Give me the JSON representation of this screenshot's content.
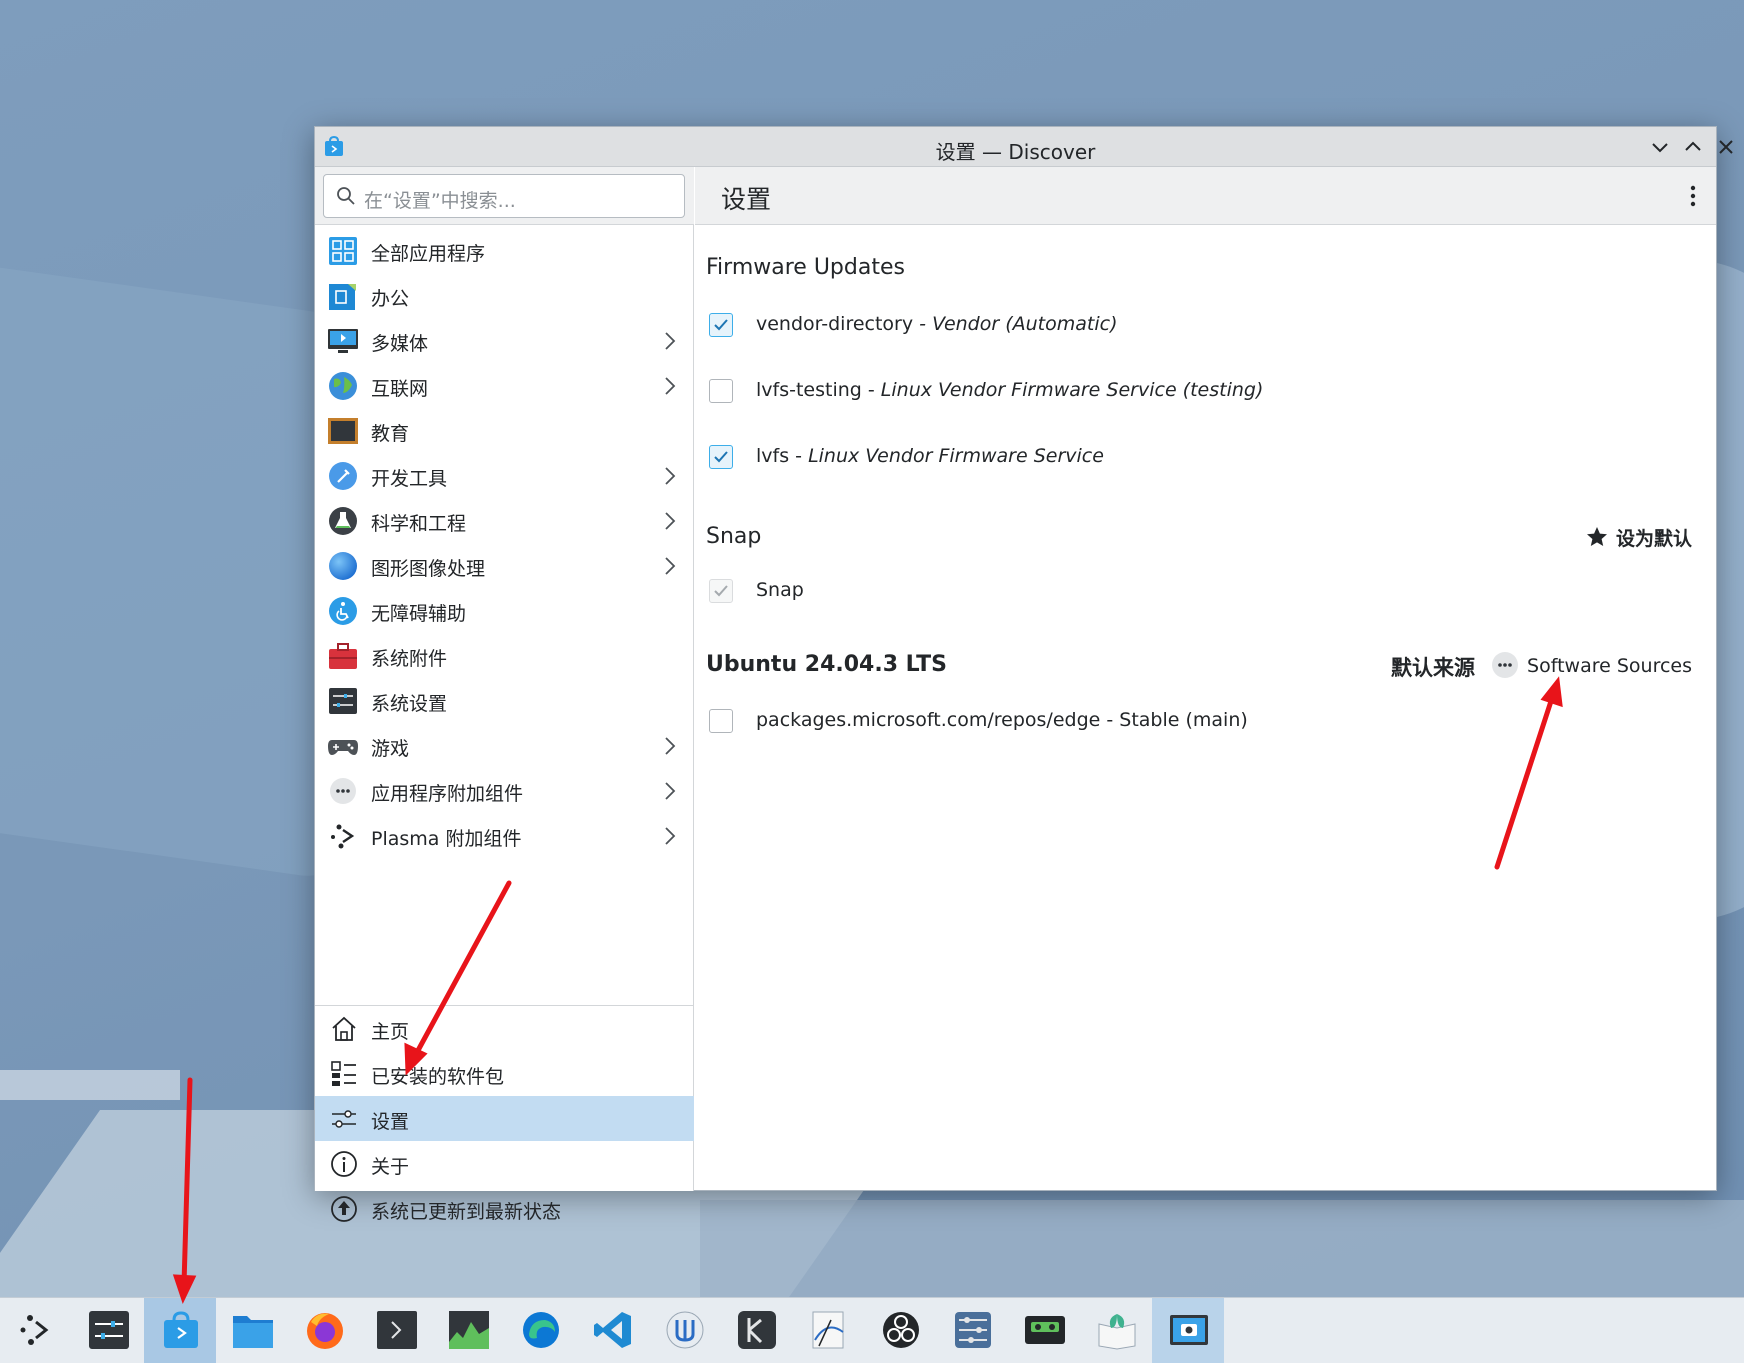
{
  "window": {
    "title": "设置 — Discover",
    "controls": [
      "chevron-down-icon",
      "chevron-up-icon",
      "close-icon"
    ]
  },
  "sidebar": {
    "search_placeholder": "在“设置”中搜索...",
    "categories": [
      {
        "label": "全部应用程序",
        "icon": "all-apps-icon",
        "has_children": false
      },
      {
        "label": "办公",
        "icon": "office-icon",
        "has_children": false
      },
      {
        "label": "多媒体",
        "icon": "multimedia-icon",
        "has_children": true
      },
      {
        "label": "互联网",
        "icon": "internet-globe-icon",
        "has_children": true
      },
      {
        "label": "教育",
        "icon": "education-blackboard-icon",
        "has_children": false
      },
      {
        "label": "开发工具",
        "icon": "development-tools-icon",
        "has_children": true
      },
      {
        "label": "科学和工程",
        "icon": "science-flask-icon",
        "has_children": true
      },
      {
        "label": "图形图像处理",
        "icon": "graphics-icon",
        "has_children": true
      },
      {
        "label": "无障碍辅助",
        "icon": "accessibility-icon",
        "has_children": false
      },
      {
        "label": "系统附件",
        "icon": "toolbox-icon",
        "has_children": false
      },
      {
        "label": "系统设置",
        "icon": "system-settings-icon",
        "has_children": false
      },
      {
        "label": "游戏",
        "icon": "gamepad-icon",
        "has_children": true
      },
      {
        "label": "应用程序附加组件",
        "icon": "addons-icon",
        "has_children": true
      },
      {
        "label": "Plasma 附加组件",
        "icon": "plasma-icon",
        "has_children": true
      }
    ],
    "nav": [
      {
        "label": "主页",
        "icon": "home-icon",
        "active": false
      },
      {
        "label": "已安装的软件包",
        "icon": "installed-packages-icon",
        "active": false
      },
      {
        "label": "设置",
        "icon": "settings-sliders-icon",
        "active": true
      },
      {
        "label": "关于",
        "icon": "info-icon",
        "active": false
      },
      {
        "label": "系统已更新到最新状态",
        "icon": "update-icon",
        "active": false
      }
    ]
  },
  "main": {
    "header": "设置",
    "firmware": {
      "title": "Firmware Updates",
      "items": [
        {
          "name": "vendor-directory",
          "sep": " - ",
          "desc": "Vendor (Automatic)",
          "checked": true
        },
        {
          "name": "lvfs-testing",
          "sep": " - ",
          "desc": "Linux Vendor Firmware Service (testing)",
          "checked": false
        },
        {
          "name": "lvfs",
          "sep": " - ",
          "desc": "Linux Vendor Firmware Service",
          "checked": true
        }
      ]
    },
    "snap": {
      "title": "Snap",
      "make_default": "设为默认",
      "item": "Snap"
    },
    "ubuntu": {
      "title": "Ubuntu 24.04.3 LTS",
      "default_source": "默认来源",
      "software_sources": "Software Sources",
      "item": "packages.microsoft.com/repos/edge - Stable (main)"
    }
  },
  "taskbar": {
    "items": [
      "kde-launcher-icon",
      "system-settings-icon",
      "discover-icon",
      "file-manager-icon",
      "firefox-icon",
      "terminal-icon",
      "system-monitor-icon",
      "edge-icon",
      "vscode-icon",
      "kde-connect-icon",
      "kdenlive-icon",
      "inkscape-icon",
      "obs-icon",
      "settings-app-icon",
      "cassette-icon",
      "book-reader-icon",
      "spectacle-icon"
    ]
  },
  "colors": {
    "accent": "#3daee9",
    "selection": "#c2dcf2",
    "annotation_arrow": "#e8141a"
  }
}
